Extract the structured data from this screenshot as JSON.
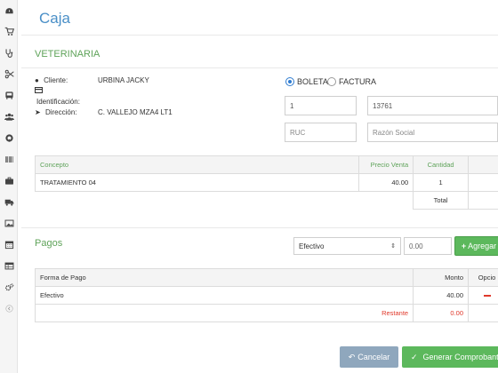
{
  "sidebar": {
    "icons": [
      "dashboard-icon",
      "cart-icon",
      "stethoscope-icon",
      "scissors-icon",
      "bus-icon",
      "users-icon",
      "github-icon",
      "barcode-icon",
      "briefcase-icon",
      "truck-icon",
      "image-icon",
      "calendar-icon",
      "table-icon",
      "cogs-icon",
      "collapse-icon"
    ]
  },
  "page": {
    "title": "Caja"
  },
  "section": {
    "title": "VETERINARIA"
  },
  "client": {
    "cliente_label": "Cliente:",
    "cliente_value": "URBINA JACKY",
    "identificacion_label": "Identificación:",
    "direccion_label": "Dirección:",
    "direccion_value": "C. VALLEJO MZA4 LT1"
  },
  "doc": {
    "boleta_label": "BOLETA",
    "factura_label": "FACTURA",
    "selected": "BOLETA",
    "serie_value": "1",
    "numero_value": "13761",
    "ruc_placeholder": "RUC",
    "razon_placeholder": "Razón Social"
  },
  "items_table": {
    "headers": {
      "concepto": "Concepto",
      "precio": "Precio Venta",
      "cantidad": "Cantidad"
    },
    "rows": [
      {
        "concepto": "TRATAMIENTO 04",
        "precio": "40.00",
        "cantidad": "1"
      }
    ],
    "total_label": "Total"
  },
  "pagos": {
    "title": "Pagos",
    "method_selected": "Efectivo",
    "amount_placeholder": "0.00",
    "add_label": "Agregar",
    "headers": {
      "forma": "Forma de Pago",
      "monto": "Monto",
      "opciones": "Opcio"
    },
    "rows": [
      {
        "forma": "Efectivo",
        "monto": "40.00"
      }
    ],
    "restante_label": "Restante",
    "restante_value": "0.00"
  },
  "actions": {
    "cancel_label": "Cancelar",
    "generate_label": "Generar Comprobant"
  },
  "colors": {
    "accent_blue": "#4a8fc7",
    "section_green": "#5fa35a",
    "danger_red": "#e0392b",
    "btn_green": "#5cb85c",
    "btn_gray": "#8fa7bd"
  }
}
